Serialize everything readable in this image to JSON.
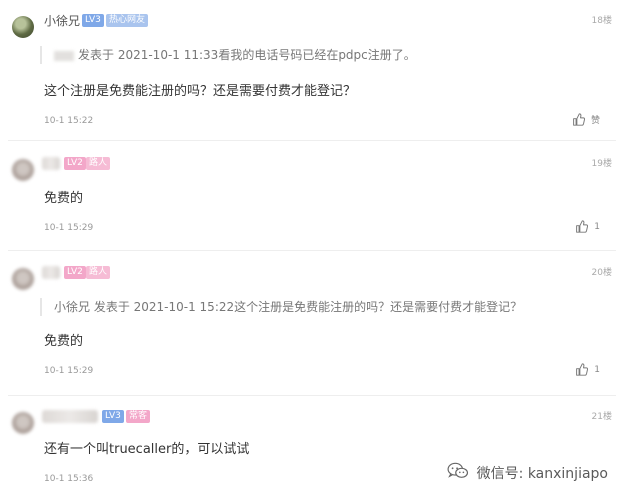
{
  "comments": [
    {
      "user": "小徐兄",
      "level": "LV3",
      "tag": "热心网友",
      "floor": "18楼",
      "quote": "发表于 2021-10-1 11:33看我的电话号码已经在pdpc注册了。",
      "body": "这个注册是免费能注册的吗？还是需要付费才能登记？",
      "time": "10-1 15:22",
      "likes": "赞"
    },
    {
      "level": "LV2",
      "tag": "路人",
      "floor": "19楼",
      "body": "免费的",
      "time": "10-1 15:29",
      "likes": "1"
    },
    {
      "level": "LV2",
      "tag": "路人",
      "floor": "20楼",
      "quote": "小徐兄 发表于 2021-10-1 15:22这个注册是免费能注册的吗？还是需要付费才能登记？",
      "body": "免费的",
      "time": "10-1 15:29",
      "likes": "1"
    },
    {
      "level": "LV3",
      "tag": "常客",
      "floor": "21楼",
      "body": "还有一个叫truecaller的，可以试试",
      "time": "10-1 15:36",
      "likes": ""
    }
  ],
  "watermark": {
    "text": "微信号: kanxinjiapo",
    "icon": "wechat-icon"
  },
  "icons": {
    "like": "thumbs-up-icon"
  },
  "colors": {
    "level_badge": "#7fa8e8",
    "level_badge_pink": "#f3a7c9",
    "text": "#333333",
    "meta": "#999999"
  }
}
